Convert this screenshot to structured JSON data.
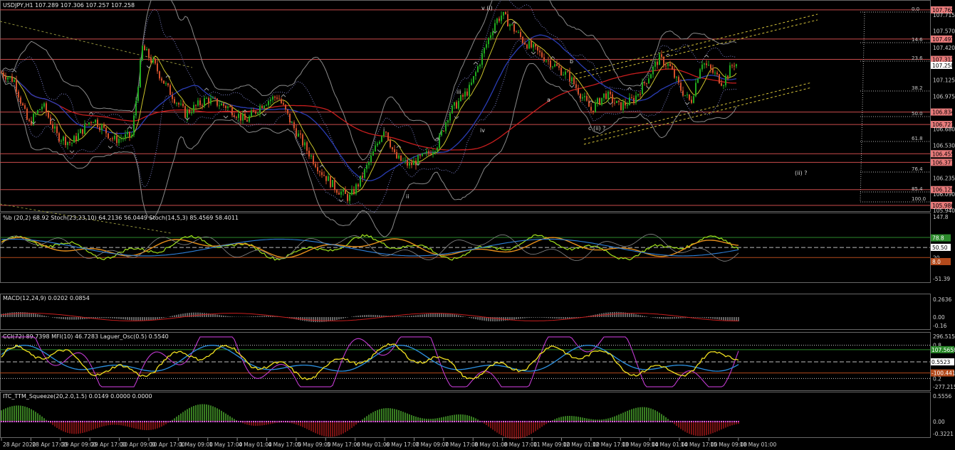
{
  "window": {
    "symbol_header": "USDJPY,H1  107.289 107.306 107.257 107.258"
  },
  "main": {
    "price_levels": [
      {
        "label": "107.762",
        "highlight": true
      },
      {
        "label": "107.715",
        "highlight": false
      },
      {
        "label": "107.570",
        "highlight": false
      },
      {
        "label": "107.497",
        "highlight": true
      },
      {
        "label": "107.420",
        "highlight": false
      },
      {
        "label": "107.312",
        "highlight": true
      },
      {
        "label": "107.258",
        "highlight": false,
        "current": true
      },
      {
        "label": "107.125",
        "highlight": false
      },
      {
        "label": "106.975",
        "highlight": false
      },
      {
        "label": "106.834",
        "highlight": true
      },
      {
        "label": "106.721",
        "highlight": true
      },
      {
        "label": "106.680",
        "highlight": false
      },
      {
        "label": "106.530",
        "highlight": false
      },
      {
        "label": "106.455",
        "highlight": true
      },
      {
        "label": "106.377",
        "highlight": true
      },
      {
        "label": "106.235",
        "highlight": false
      },
      {
        "label": "106.090",
        "highlight": false
      },
      {
        "label": "106.129",
        "highlight": true
      },
      {
        "label": "105.986",
        "highlight": true
      },
      {
        "label": "105.940",
        "highlight": false
      }
    ],
    "fib_levels": [
      "0.0",
      "14.6",
      "23.6",
      "38.2",
      "50.0",
      "61.8",
      "76.4",
      "85.4",
      "100.0"
    ],
    "wave_labels": [
      "v (i)",
      "b",
      "a",
      "c (ii) ?",
      "(ii) ?",
      "iii",
      "iv",
      "i",
      "ii"
    ],
    "colors": {
      "horizontal": "#c94b4b",
      "fib": "#b0b0b0",
      "channel": "#d4c23a",
      "ma_red": "#c81e1e",
      "ma_blue": "#2a3db5",
      "bull": "#1fa81f",
      "bear": "#d2502a"
    }
  },
  "stoch_panel": {
    "header": "%b (20,2) 68.92  Stoch(23,23,10) 64.2136 56.0449  Stoch(14,5,3) 85.4569 58.4011",
    "scale": [
      "147.8",
      "80",
      "50.50",
      "20",
      "-51.39"
    ],
    "tags": [
      {
        "label": "78.8",
        "color": "#2b8a2b"
      },
      {
        "label": "50.50",
        "color": "#ffffff"
      },
      {
        "label": "8.0",
        "color": "#b34a1c"
      }
    ]
  },
  "macd_panel": {
    "header": "MACD(12,24,9) 0.0202 0.0854",
    "scale": [
      "0.2636",
      "0.00",
      "-0.16"
    ]
  },
  "cci_panel": {
    "header": "CCI(72) 89.7398  MFI(10) 46.7283  Laguer_Osc(0.5) 0.5540",
    "scale": [
      "296.5158",
      "0.8",
      "0.5523",
      "0.2",
      "-277.2154"
    ],
    "tags": [
      {
        "label": "107.5658",
        "color": "#2b8a2b"
      },
      {
        "label": "0.5523",
        "color": "#ffffff"
      },
      {
        "label": "-100.4412",
        "color": "#b34a1c"
      }
    ]
  },
  "squeeze_panel": {
    "header": "ITC_TTM_Squeeze(20,2.0,1.5) 0.0149 0.0000 0.0000",
    "scale": [
      "0.5556",
      "0.00",
      "-0.3221"
    ]
  },
  "time_axis": [
    "28 Apr 2020",
    "28 Apr 17:00",
    "29 Apr 09:00",
    "29 Apr 17:00",
    "30 Apr 09:00",
    "30 Apr 17:00",
    "1 May 09:00",
    "1 May 17:00",
    "4 May 01:00",
    "4 May 17:00",
    "5 May 09:00",
    "5 May 17:00",
    "6 May 01:00",
    "6 May 17:00",
    "7 May 09:00",
    "7 May 17:00",
    "8 May 01:00",
    "8 May 17:00",
    "11 May 09:00",
    "12 May 01:00",
    "12 May 17:00",
    "13 May 09:00",
    "14 May 01:00",
    "14 May 17:00",
    "15 May 09:00",
    "18 May 01:00"
  ]
}
